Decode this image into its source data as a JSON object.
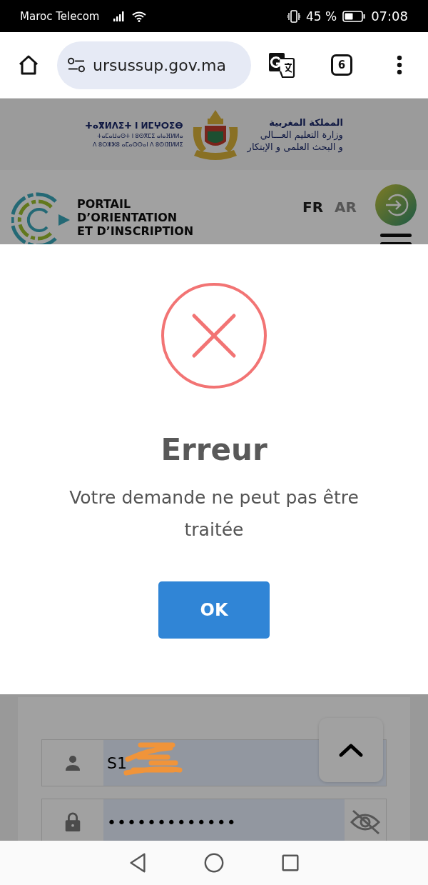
{
  "status_bar": {
    "carrier": "Maroc Telecom",
    "battery": "45 %",
    "time": "07:08"
  },
  "browser": {
    "url": "ursussup.gov.ma",
    "tab_count": "6"
  },
  "ministry_banner": {
    "tifinagh_lines": [
      "ⵜⴰⴳⵍⴷⵉⵜ ⵏ ⵍⵎⵖⵔⵉⴱ",
      "ⵜⴰⵎⴰⵡⴰⵙⵜ ⵏ ⵓⵙⴳⵎⵉ ⴰⵏⴰⴼⵍⵍⴰ",
      "ⴷ ⵓⵔⵣⵣⵓ ⴰⵎⴰⵙⵙⴰⵏ ⴷ ⵓⵙⵏⴼⵍⵍⵉ"
    ],
    "arabic_lines": [
      "المملكة المغربية",
      "وزارة التعليم العـــالي",
      "و البحث العلمي و الإبتكار"
    ]
  },
  "portal_header": {
    "title_lines": [
      "PORTAIL",
      "D’ORIENTATION",
      "ET D’INSCRIPTION"
    ],
    "languages": [
      {
        "label": "FR",
        "selected": true
      },
      {
        "label": "AR",
        "selected": false
      }
    ]
  },
  "login_form": {
    "username": "S1",
    "password": "•••••••••••••"
  },
  "dialog": {
    "kind": "error",
    "title": "Erreur",
    "message": "Votre demande ne peut pas être traitée",
    "button": "OK"
  }
}
